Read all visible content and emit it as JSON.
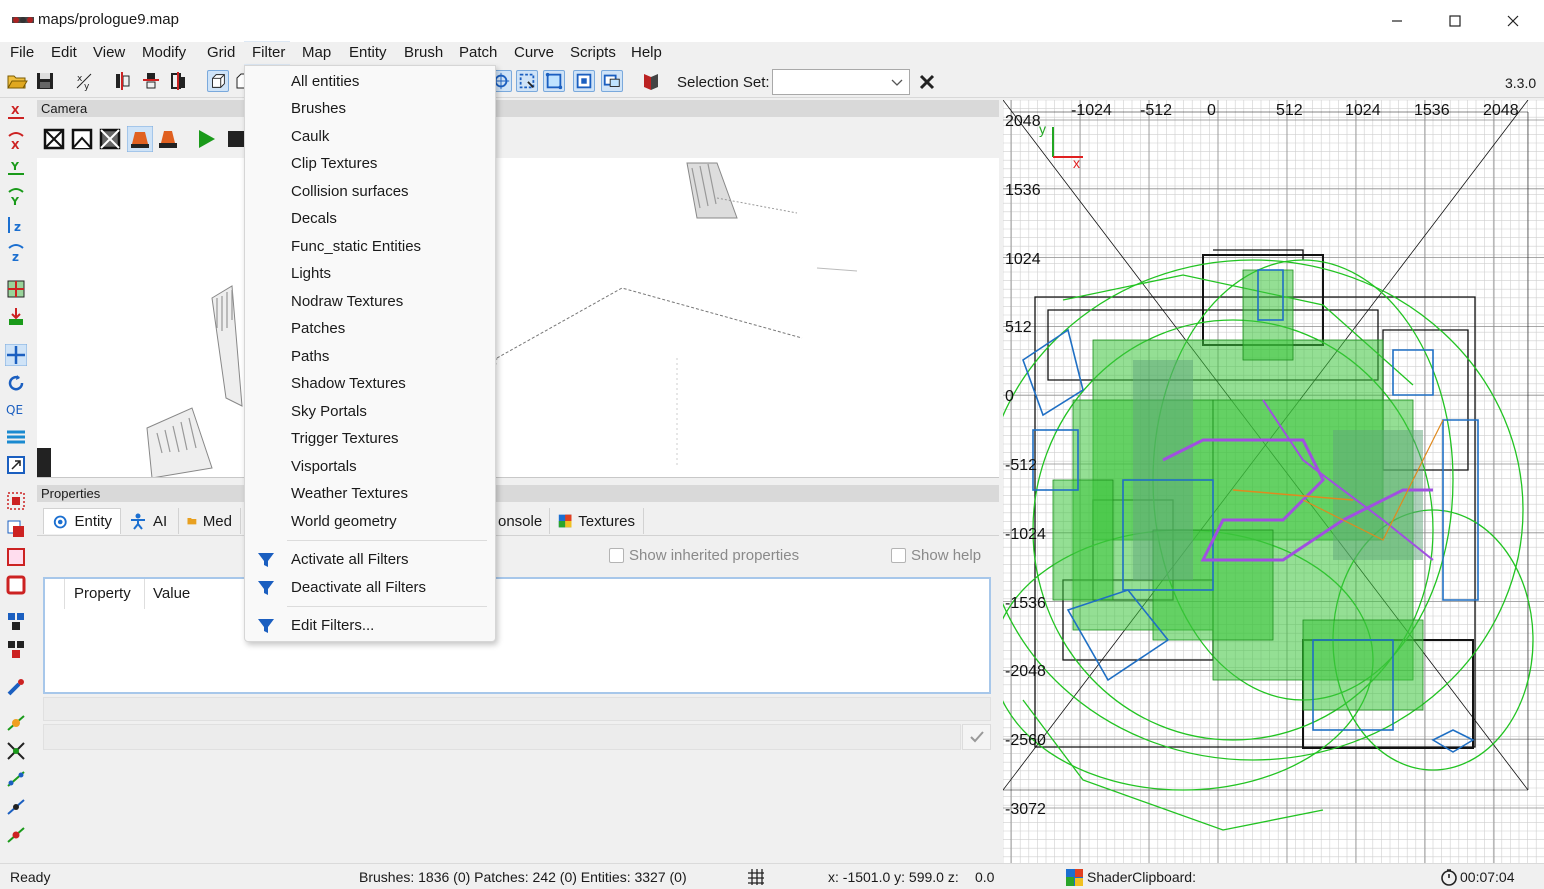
{
  "window": {
    "title": "maps/prologue9.map",
    "controls": [
      "minimize",
      "maximize",
      "close"
    ]
  },
  "menubar": {
    "items": [
      "File",
      "Edit",
      "View",
      "Modify",
      "Grid",
      "Filter",
      "Map",
      "Entity",
      "Brush",
      "Patch",
      "Curve",
      "Scripts",
      "Help"
    ],
    "open_item": "Filter"
  },
  "toolbar": {
    "selection_set_label": "Selection Set:",
    "selection_set_value": "",
    "version": "3.3.0"
  },
  "camera": {
    "title": "Camera"
  },
  "properties": {
    "title": "Properties",
    "tabs": [
      {
        "label": "Entity",
        "icon": "entity-icon",
        "active": true
      },
      {
        "label": "AI",
        "icon": "ai-icon",
        "active": false
      },
      {
        "label": "Med",
        "icon": "media-folder-icon",
        "active": false
      },
      {
        "label": "onsole",
        "icon": "console-icon",
        "active": false
      },
      {
        "label": "Textures",
        "icon": "textures-icon",
        "active": false
      }
    ],
    "show_inherited_label": "Show inherited properties",
    "show_help_label": "Show help",
    "columns": [
      "Property",
      "Value"
    ]
  },
  "ortho": {
    "top_ticks": [
      "-1024",
      "-512",
      "0",
      "512",
      "1024",
      "1536",
      "2048"
    ],
    "left_ticks": [
      "2048",
      "1536",
      "1024",
      "512",
      "0",
      "-512",
      "-1024",
      "-1536",
      "-2048",
      "-2560",
      "-3072"
    ],
    "axis_x_label": "x",
    "axis_y_label": "y",
    "accent_colors": {
      "green": "#22c322",
      "blue": "#1f6fc4",
      "black": "#111111",
      "purple": "#a050e0",
      "orange": "#e08a1e"
    }
  },
  "statusbar": {
    "ready": "Ready",
    "counts": "Brushes: 1836 (0) Patches: 242 (0) Entities: 3327 (0)",
    "coords": "x:  -1501.0  y:   599.0  z:",
    "z_value": "0.0",
    "shader_clipboard": "ShaderClipboard:",
    "timer": "00:07:04"
  },
  "filter_menu": {
    "items": [
      "All entities",
      "Brushes",
      "Caulk",
      "Clip Textures",
      "Collision surfaces",
      "Decals",
      "Func_static Entities",
      "Lights",
      "Nodraw Textures",
      "Patches",
      "Paths",
      "Shadow Textures",
      "Sky Portals",
      "Trigger Textures",
      "Visportals",
      "Weather Textures",
      "World geometry"
    ],
    "actions": [
      "Activate all Filters",
      "Deactivate all Filters"
    ],
    "edit": "Edit Filters..."
  }
}
